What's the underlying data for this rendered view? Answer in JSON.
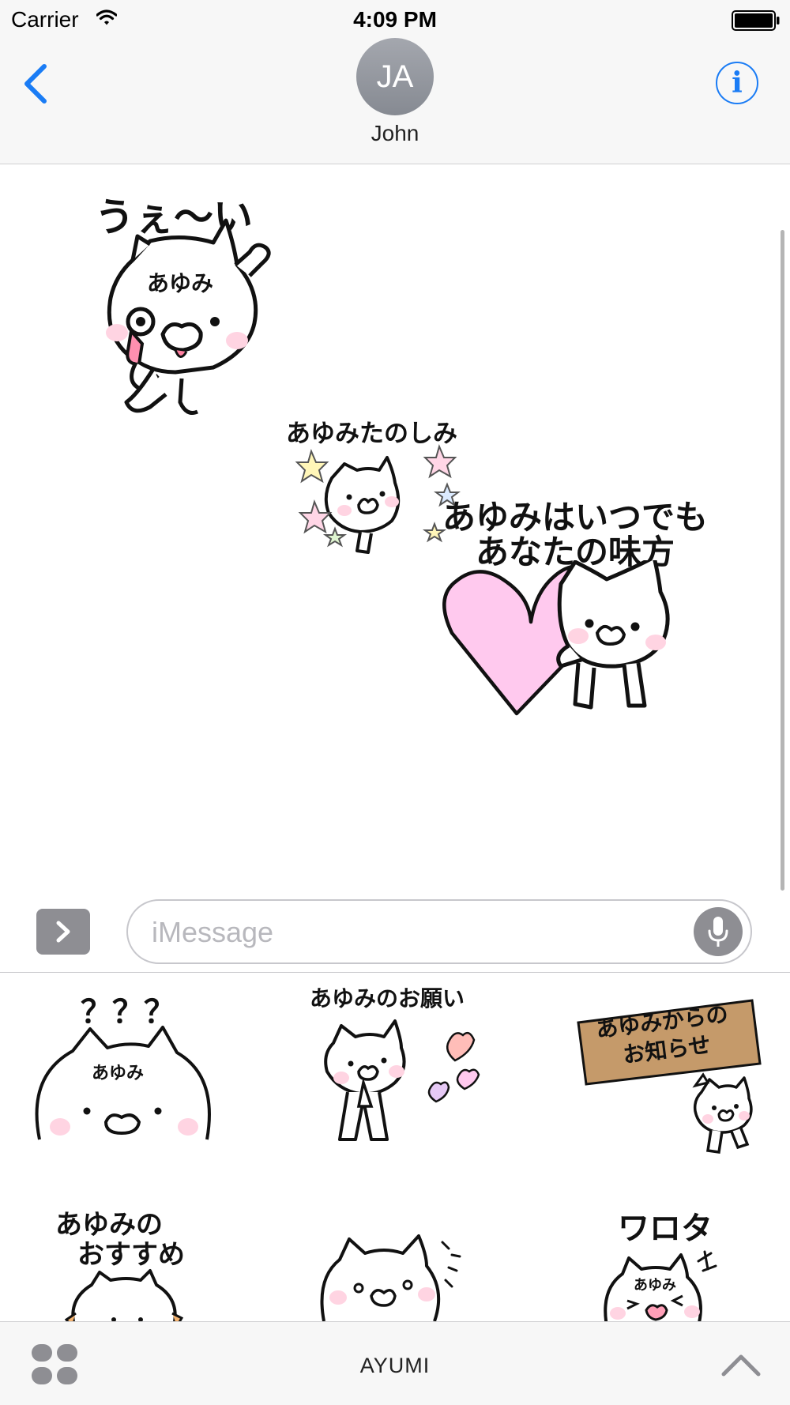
{
  "status_bar": {
    "carrier": "Carrier",
    "time": "4:09 PM",
    "icons": [
      "wifi-icon",
      "battery-icon"
    ]
  },
  "header": {
    "back_icon": "chevron-left-icon",
    "avatar_initials": "JA",
    "contact_name": "John",
    "info_icon": "info-circle-icon",
    "info_glyph": "i",
    "accent_color": "#1a7cf5"
  },
  "conversation": {
    "stickers": [
      {
        "caption": "うぇ～い",
        "name_tag": "あゆみ"
      },
      {
        "caption": "あゆみたのしみ"
      },
      {
        "caption_lines": [
          "あゆみはいつでも",
          "あなたの味方"
        ]
      }
    ]
  },
  "input_bar": {
    "apps_icon": "chevron-right-icon",
    "placeholder": "iMessage",
    "value": "",
    "mic_icon": "microphone-icon"
  },
  "sticker_drawer": {
    "stickers": [
      {
        "caption": "？？？",
        "name_tag": "あゆみ"
      },
      {
        "caption": "あゆみのお願い"
      },
      {
        "caption_lines": [
          "あゆみからの",
          "お知らせ"
        ]
      },
      {
        "caption_lines": [
          "あゆみの",
          "おすすめ"
        ]
      },
      {
        "caption": ""
      },
      {
        "caption": "ワロタ",
        "name_tag": "あゆみ"
      }
    ]
  },
  "bottom_bar": {
    "grid_icon": "app-drawer-grid-icon",
    "pack_name": "AYUMI",
    "expand_icon": "chevron-up-icon"
  }
}
